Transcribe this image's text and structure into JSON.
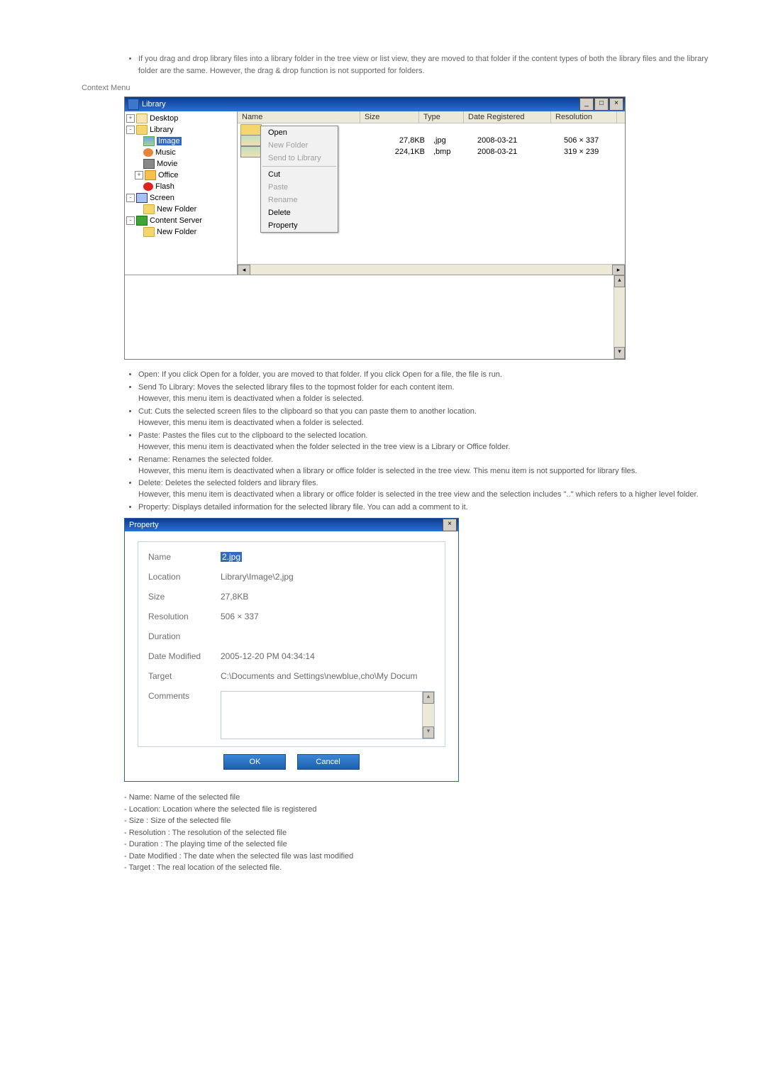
{
  "intro_bullet": "If you drag and drop library files into a library folder in the tree view or list view, they are moved to that folder if the content types of both the library files and the library folder are the same. However, the drag & drop function is not supported for folders.",
  "section_label": "Context Menu",
  "library": {
    "title": "Library",
    "win_minimize": "_",
    "win_maximize": "□",
    "win_close": "×",
    "tree": {
      "desktop": "Desktop",
      "library": "Library",
      "image": "Image",
      "music": "Music",
      "movie": "Movie",
      "office": "Office",
      "flash": "Flash",
      "screen": "Screen",
      "newfolder1": "New Folder",
      "cserver": "Content Server",
      "newfolder2": "New Folder"
    },
    "columns": {
      "name": "Name",
      "size": "Size",
      "type": "Type",
      "date": "Date Registered",
      "res": "Resolution"
    },
    "uprow": "..",
    "rows": [
      {
        "size": "27,8KB",
        "type": ",jpg",
        "date": "2008-03-21",
        "res": "506 × 337"
      },
      {
        "size": "224,1KB",
        "type": ",bmp",
        "date": "2008-03-21",
        "res": "319 × 239"
      }
    ],
    "context_menu": {
      "open": "Open",
      "newfolder": "New Folder",
      "sendlib": "Send to Library",
      "cut": "Cut",
      "paste": "Paste",
      "rename": "Rename",
      "delete": "Delete",
      "property": "Property"
    }
  },
  "explain": {
    "open": "Open: If you click Open for a folder, you are moved to that folder. If you click Open for a file, the file is run.",
    "send1": "Send To Library: Moves the selected library files to the topmost folder for each content item.",
    "send2": "However, this menu item is deactivated when a folder is selected.",
    "cut1": "Cut: Cuts the selected screen files to the clipboard so that you can paste them to another location.",
    "cut2": "However, this menu item is deactivated when a folder is selected.",
    "paste1": "Paste: Pastes the files cut to the clipboard to the selected location.",
    "paste2": "However, this menu item is deactivated when the folder selected in the tree view is a Library or Office folder.",
    "rename1": "Rename: Renames the selected folder.",
    "rename2": "However, this menu item is deactivated when a library or office folder is selected in the tree view. This menu item is not supported for library files.",
    "delete1": "Delete: Deletes the selected folders and library files.",
    "delete2": "However, this menu item is deactivated when a library or office folder is selected in the tree view and the selection includes \"..\" which refers to a higher level folder.",
    "property": "Property: Displays detailed information for the selected library file. You can add a comment to it."
  },
  "property": {
    "title": "Property",
    "close": "×",
    "labels": {
      "name": "Name",
      "location": "Location",
      "size": "Size",
      "resolution": "Resolution",
      "duration": "Duration",
      "modified": "Date Modified",
      "target": "Target",
      "comments": "Comments"
    },
    "values": {
      "name": "2.jpg",
      "location": "Library\\Image\\2,jpg",
      "size": "27,8KB",
      "resolution": "506 × 337",
      "duration": "",
      "modified": "2005-12-20 PM 04:34:14",
      "target": "C:\\Documents and Settings\\newblue,cho\\My Docum"
    },
    "buttons": {
      "ok": "OK",
      "cancel": "Cancel"
    }
  },
  "fields": {
    "name": "- Name: Name of the selected file",
    "location": "- Location: Location where the selected file is registered",
    "size": "- Size : Size of the selected file",
    "resolution": "- Resolution : The resolution of the selected file",
    "duration": "- Duration : The playing time of the selected file",
    "modified": "- Date Modified : The date when the selected file was last modified",
    "target": "- Target : The real location of the selected file."
  }
}
